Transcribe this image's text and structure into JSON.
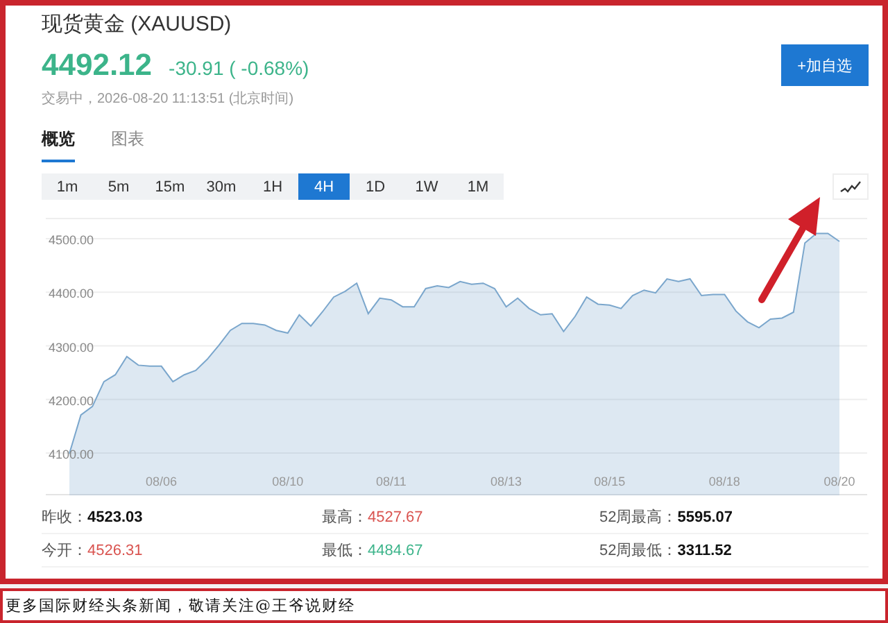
{
  "header": {
    "title": "现货黄金 (XAUUSD)",
    "price": "4492.12",
    "change": "-30.91 ( -0.68%)",
    "color": "#3cb48a",
    "status": "交易中，2026-08-20 11:13:51 (北京时间)",
    "watchlist_button": "+加自选"
  },
  "tabs": [
    {
      "label": "概览",
      "selected": true
    },
    {
      "label": "图表",
      "selected": false
    }
  ],
  "periods": [
    {
      "label": "1m",
      "selected": false
    },
    {
      "label": "5m",
      "selected": false
    },
    {
      "label": "15m",
      "selected": false
    },
    {
      "label": "30m",
      "selected": false
    },
    {
      "label": "1H",
      "selected": false
    },
    {
      "label": "4H",
      "selected": true
    },
    {
      "label": "1D",
      "selected": false
    },
    {
      "label": "1W",
      "selected": false
    },
    {
      "label": "1M",
      "selected": false
    }
  ],
  "chart": {
    "chart_data": {
      "type": "area",
      "grid": true,
      "ylim": [
        4021,
        4539
      ],
      "yticks": [
        {
          "value": 4100,
          "label": "4100.00"
        },
        {
          "value": 4200,
          "label": "4200.00"
        },
        {
          "value": 4300,
          "label": "4300.00"
        },
        {
          "value": 4400,
          "label": "4400.00"
        },
        {
          "value": 4500,
          "label": "4500.00"
        }
      ],
      "categories": [
        null,
        null,
        null,
        null,
        null,
        null,
        null,
        null,
        "08/06",
        null,
        null,
        null,
        null,
        null,
        null,
        null,
        null,
        null,
        null,
        "08/10",
        null,
        null,
        null,
        null,
        null,
        null,
        null,
        null,
        "08/11",
        null,
        null,
        null,
        null,
        null,
        null,
        null,
        null,
        null,
        "08/13",
        null,
        null,
        null,
        null,
        null,
        null,
        null,
        null,
        "08/15",
        null,
        null,
        null,
        null,
        null,
        null,
        null,
        null,
        null,
        "08/18",
        null,
        null,
        null,
        null,
        null,
        null,
        null,
        null,
        null,
        "08/20"
      ],
      "series": [
        {
          "color": "#7aa6cc",
          "values": [
            4099,
            4171,
            4187,
            4233,
            4246,
            4280,
            4264,
            4262,
            4262,
            4233,
            4246,
            4254,
            4275,
            4301,
            4329,
            4342,
            4342,
            4339,
            4329,
            4324,
            4358,
            4337,
            4363,
            4391,
            4402,
            4417,
            4360,
            4389,
            4386,
            4373,
            4373,
            4407,
            4412,
            4409,
            4420,
            4415,
            4417,
            4407,
            4373,
            4389,
            4370,
            4358,
            4360,
            4327,
            4355,
            4391,
            4378,
            4376,
            4370,
            4394,
            4404,
            4399,
            4425,
            4420,
            4425,
            4394,
            4396,
            4396,
            4365,
            4345,
            4334,
            4350,
            4352,
            4363,
            4492,
            4510,
            4510,
            4495
          ]
        }
      ]
    }
  },
  "stats": [
    {
      "label": "昨收：",
      "value": "4523.03",
      "color": "#111111",
      "bold": true
    },
    {
      "label": "最高：",
      "value": "4527.67",
      "color": "#d9534f",
      "bold": false
    },
    {
      "label": "52周最高：",
      "value": "5595.07",
      "color": "#111111",
      "bold": true
    },
    {
      "label": "今开：",
      "value": "4526.31",
      "color": "#d9534f",
      "bold": false
    },
    {
      "label": "最低：",
      "value": "4484.67",
      "color": "#3cb48a",
      "bold": false
    },
    {
      "label": "52周最低：",
      "value": "3311.52",
      "color": "#111111",
      "bold": true
    }
  ],
  "caption": "更多国际财经头条新闻，敬请关注@王爷说财经"
}
